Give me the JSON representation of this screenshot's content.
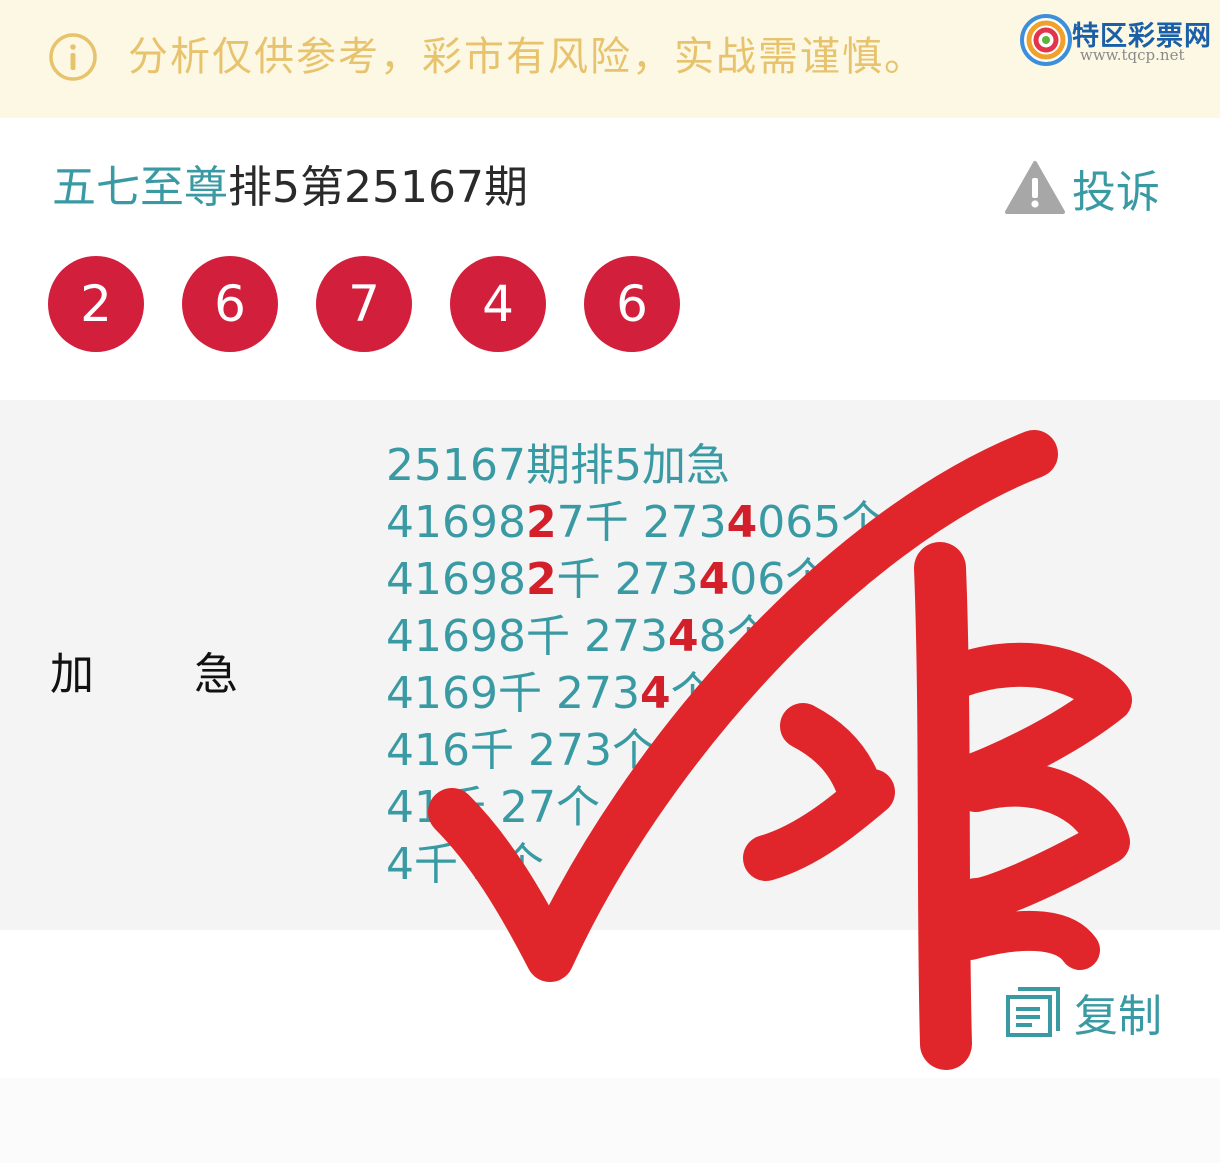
{
  "notice": {
    "text": "分析仅供参考，彩市有风险，实战需谨慎。",
    "icon": "info-circle-icon",
    "color": "#e7c36d"
  },
  "logo": {
    "name": "特区彩票网",
    "url": "www.tqcp.net"
  },
  "header": {
    "author": "五七至尊",
    "issue": "排5第25167期",
    "complain_label": "投诉"
  },
  "balls": [
    "2",
    "6",
    "7",
    "4",
    "6"
  ],
  "panel": {
    "label": "加急",
    "lines": [
      {
        "segments": [
          {
            "text": "25167期排5加急"
          }
        ]
      },
      {
        "segments": [
          {
            "text": "41698"
          },
          {
            "text": "2",
            "hit": true
          },
          {
            "text": "7千 273"
          },
          {
            "text": "4",
            "hit": true
          },
          {
            "text": "065个"
          }
        ]
      },
      {
        "segments": [
          {
            "text": "41698"
          },
          {
            "text": "2",
            "hit": true
          },
          {
            "text": "千 273"
          },
          {
            "text": "4",
            "hit": true
          },
          {
            "text": "06个"
          }
        ]
      },
      {
        "segments": [
          {
            "text": "41698千 273"
          },
          {
            "text": "4",
            "hit": true
          },
          {
            "text": "8个"
          }
        ]
      },
      {
        "segments": [
          {
            "text": "4169千 273"
          },
          {
            "text": "4",
            "hit": true
          },
          {
            "text": "个"
          }
        ]
      },
      {
        "segments": [
          {
            "text": "416千 273个"
          }
        ]
      },
      {
        "segments": [
          {
            "text": "41千 27个"
          }
        ]
      },
      {
        "segments": [
          {
            "text": "4千 2个"
          }
        ]
      }
    ]
  },
  "copy_label": "复制",
  "stamp": {
    "text": "准",
    "color": "#e0262a"
  },
  "colors": {
    "accent": "#3a9aa3",
    "ball": "#d21f3c",
    "hit": "#d21f2a"
  }
}
